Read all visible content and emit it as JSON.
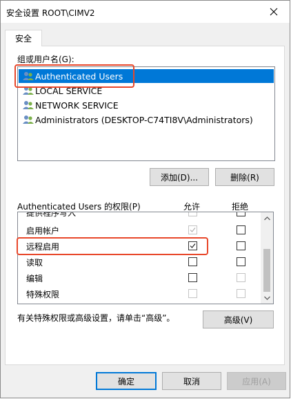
{
  "window": {
    "title": "安全设置 ROOT\\CIMV2"
  },
  "tabs": [
    {
      "label": "安全"
    }
  ],
  "group_section": {
    "label": "组或用户名(G):",
    "users": [
      {
        "name": "Authenticated Users",
        "selected": true
      },
      {
        "name": "LOCAL SERVICE",
        "selected": false
      },
      {
        "name": "NETWORK SERVICE",
        "selected": false
      },
      {
        "name": "Administrators (DESKTOP-C74TI8V\\Administrators)",
        "selected": false
      }
    ],
    "add_button": "添加(D)...",
    "remove_button": "删除(R)"
  },
  "permissions": {
    "title": "Authenticated Users 的权限(P)",
    "allow_header": "允许",
    "deny_header": "拒绝",
    "rows": [
      {
        "name": "提供程序写入",
        "allow": false,
        "allow_disabled": true,
        "deny": false,
        "deny_disabled": false
      },
      {
        "name": "启用帐户",
        "allow": true,
        "allow_disabled": true,
        "deny": false,
        "deny_disabled": false
      },
      {
        "name": "远程启用",
        "allow": true,
        "allow_disabled": false,
        "deny": false,
        "deny_disabled": false
      },
      {
        "name": "读取",
        "allow": false,
        "allow_disabled": false,
        "deny": false,
        "deny_disabled": false
      },
      {
        "name": "编辑",
        "allow": false,
        "allow_disabled": false,
        "deny": false,
        "deny_disabled": true
      },
      {
        "name": "特殊权限",
        "allow": false,
        "allow_disabled": true,
        "deny": false,
        "deny_disabled": true
      }
    ]
  },
  "advanced": {
    "text": "有关特殊权限或高级设置，请单击“高级”。",
    "button": "高级(V)"
  },
  "footer": {
    "ok": "确定",
    "cancel": "取消",
    "apply": "应用(A)"
  },
  "colors": {
    "selection": "#0078d7",
    "highlight_annotation": "#e8472a"
  }
}
